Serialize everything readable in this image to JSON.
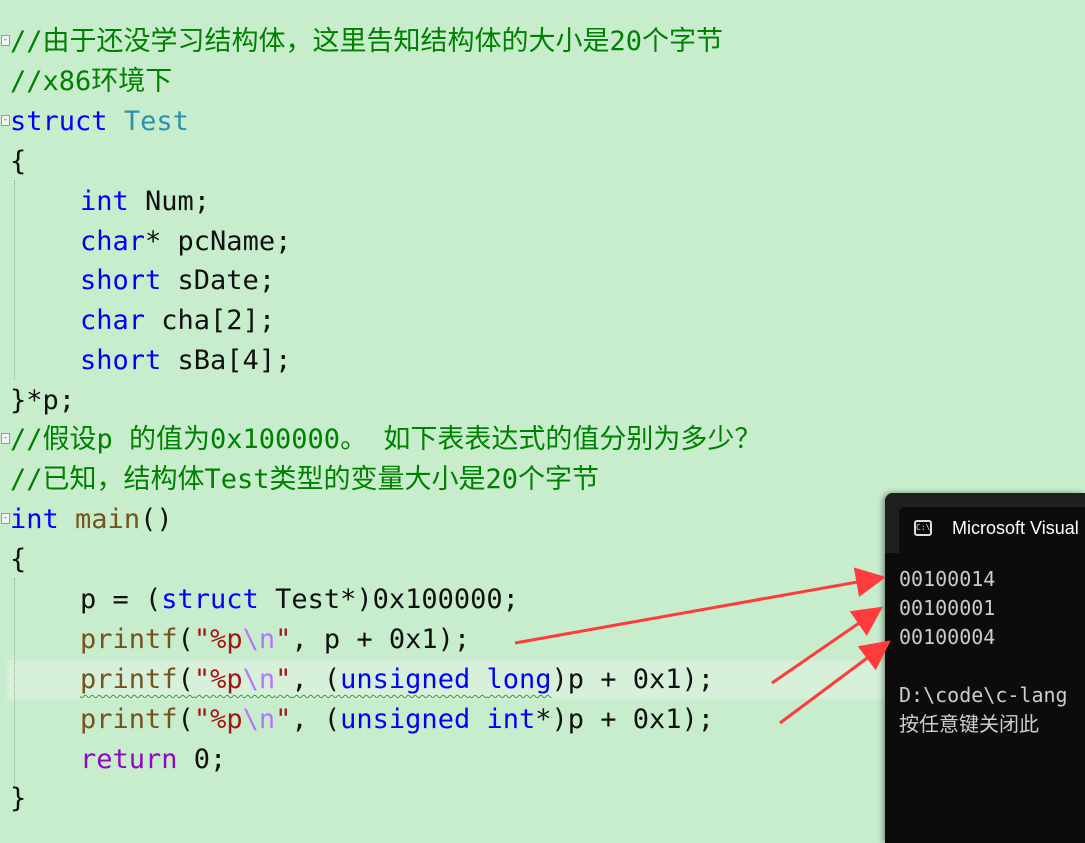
{
  "editor": {
    "comment1": "//由于还没学习结构体，这里告知结构体的大小是20个字节",
    "comment2": "//x86环境下",
    "struct_kw": "struct",
    "struct_name": "Test",
    "open_brace": "{",
    "fields": [
      {
        "type": "int",
        "rest": " Num;"
      },
      {
        "type": "char",
        "rest": "* pcName;"
      },
      {
        "type": "short",
        "rest": " sDate;"
      },
      {
        "type": "char",
        "rest": " cha[2];"
      },
      {
        "type": "short",
        "rest": " sBa[4];"
      }
    ],
    "struct_close": "}*p;",
    "comment3": "//假设p 的值为0x100000。 如下表表达式的值分别为多少？",
    "comment4": "//已知，结构体Test类型的变量大小是20个字节",
    "main_kw": "int",
    "main_fn": "main",
    "main_paren": "()",
    "assign": {
      "pre": "p = (",
      "kw": "struct",
      "post": " Test*)0x100000;"
    },
    "printf_fn": "printf",
    "fmt_open": "\"%p",
    "fmt_esc": "\\n",
    "fmt_close": "\"",
    "printf1_rest": ", p + 0x1);",
    "printf2": {
      "pre": ", (",
      "kw1": "unsigned",
      "sp": " ",
      "kw2": "long",
      "post": ")p + 0x1);"
    },
    "printf3": {
      "pre": ", (",
      "kw1": "unsigned",
      "sp": " ",
      "kw2": "int",
      "post": "*)p + 0x1);"
    },
    "return_kw": "return",
    "return_rest": " 0;",
    "close_brace": "}"
  },
  "console": {
    "title": "Microsoft Visual",
    "icon": "console-icon",
    "icon_text": "C:\\",
    "lines": [
      "00100014",
      "00100001",
      "00100004",
      "",
      "D:\\code\\c-lang",
      "按任意键关闭此"
    ]
  },
  "colors": {
    "background": "#c7edcc",
    "comment": "#008000",
    "keyword": "#0000ff",
    "type": "#2b91af",
    "function": "#74531f",
    "string": "#a31515",
    "return": "#8f08c4",
    "arrow": "#ff3b3b",
    "console_bg": "#0c0c0c"
  }
}
